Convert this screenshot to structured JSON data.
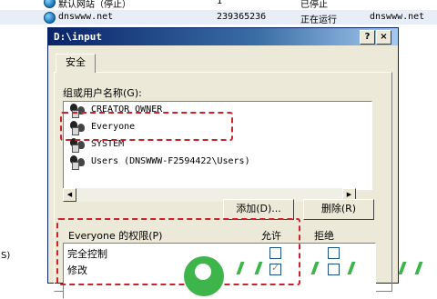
{
  "background_list": {
    "rows": [
      {
        "name": "默认网站（停止）",
        "id": "1",
        "status": "已停止",
        "host": ""
      },
      {
        "name": "dnswww.net",
        "id": "239365236",
        "status": "正在运行",
        "host": "dnswww.net"
      }
    ],
    "left_edge_text": "S)"
  },
  "dialog": {
    "title": "D:\\input",
    "help_label": "?",
    "close_label": "×",
    "tab_label": "安全",
    "groups_label": "组或用户名称(G):",
    "users": [
      {
        "name": "CREATOR OWNER"
      },
      {
        "name": "Everyone"
      },
      {
        "name": "SYSTEM"
      },
      {
        "name": "Users (DNSWWW-F2594422\\Users)"
      }
    ],
    "add_button": "添加(D)...",
    "remove_button": "删除(R)",
    "permissions": {
      "header": "Everyone 的权限(P)",
      "allow": "允许",
      "deny": "拒绝",
      "rows": [
        {
          "label": "完全控制",
          "allow": false,
          "deny": false
        },
        {
          "label": "修改",
          "allow": true,
          "deny": false
        }
      ]
    }
  },
  "icons": {
    "website": "globe-icon",
    "user": "users-group-icon"
  },
  "colors": {
    "highlight_annotation": "#c8232b",
    "title_bar": "#0a246a",
    "dialog_face": "#ece9d8",
    "watermark": "#3db54a"
  }
}
